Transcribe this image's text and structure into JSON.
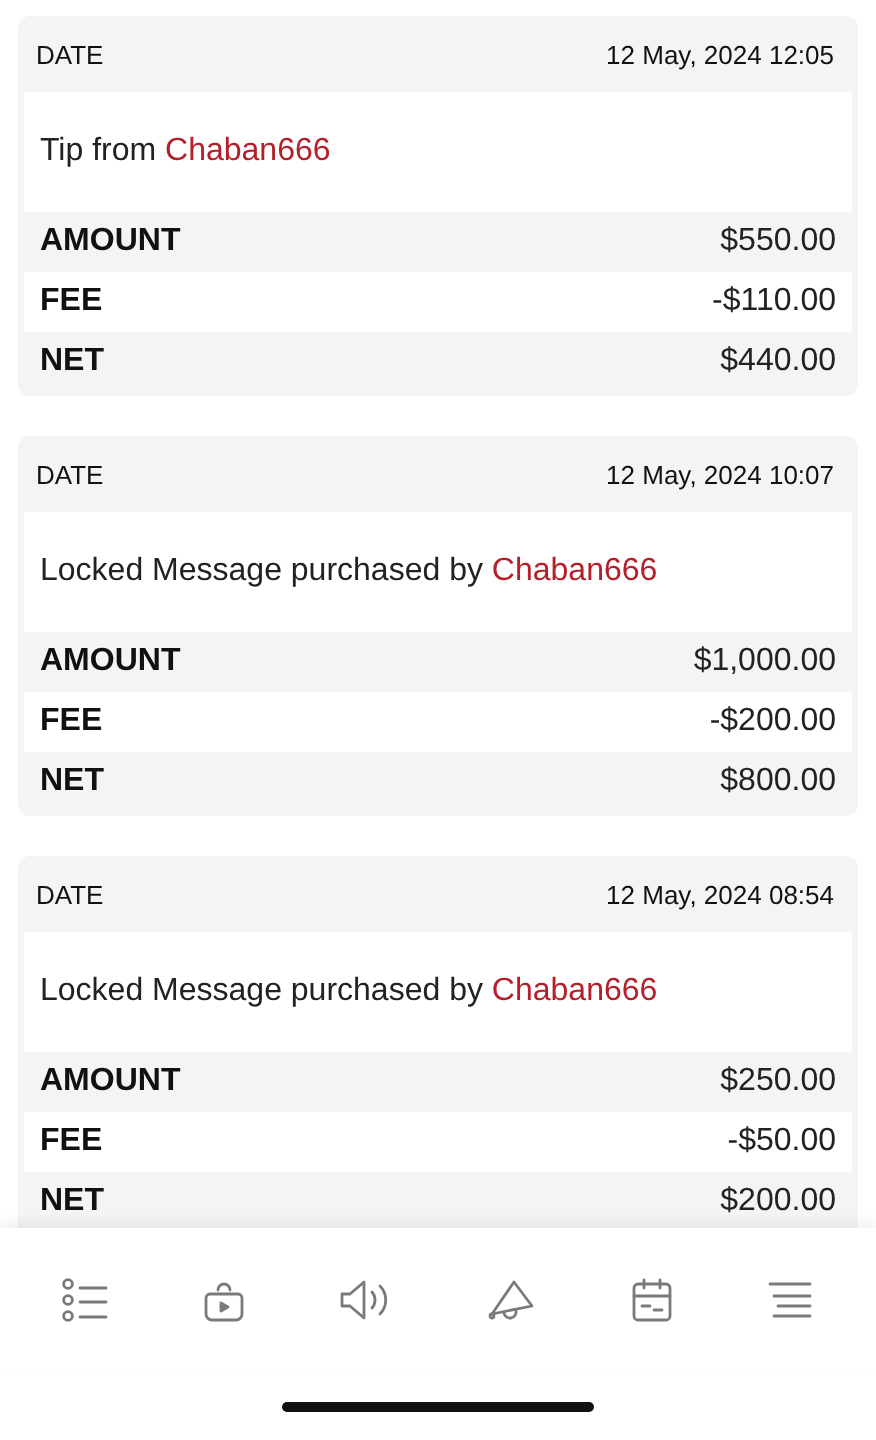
{
  "transactions": [
    {
      "date_label": "DATE",
      "date": "12 May, 2024 12:05",
      "description": "Tip from",
      "user": "Chaban666",
      "rows": [
        {
          "label": "AMOUNT",
          "value": "$550.00"
        },
        {
          "label": "FEE",
          "value": "-$110.00"
        },
        {
          "label": "NET",
          "value": "$440.00"
        }
      ]
    },
    {
      "date_label": "DATE",
      "date": "12 May, 2024 10:07",
      "description": "Locked Message purchased by",
      "user": "Chaban666",
      "rows": [
        {
          "label": "AMOUNT",
          "value": "$1,000.00"
        },
        {
          "label": "FEE",
          "value": "-$200.00"
        },
        {
          "label": "NET",
          "value": "$800.00"
        }
      ]
    },
    {
      "date_label": "DATE",
      "date": "12 May, 2024 08:54",
      "description": "Locked Message purchased by",
      "user": "Chaban666",
      "rows": [
        {
          "label": "AMOUNT",
          "value": "$250.00"
        },
        {
          "label": "FEE",
          "value": "-$50.00"
        },
        {
          "label": "NET",
          "value": "$200.00"
        }
      ]
    }
  ]
}
